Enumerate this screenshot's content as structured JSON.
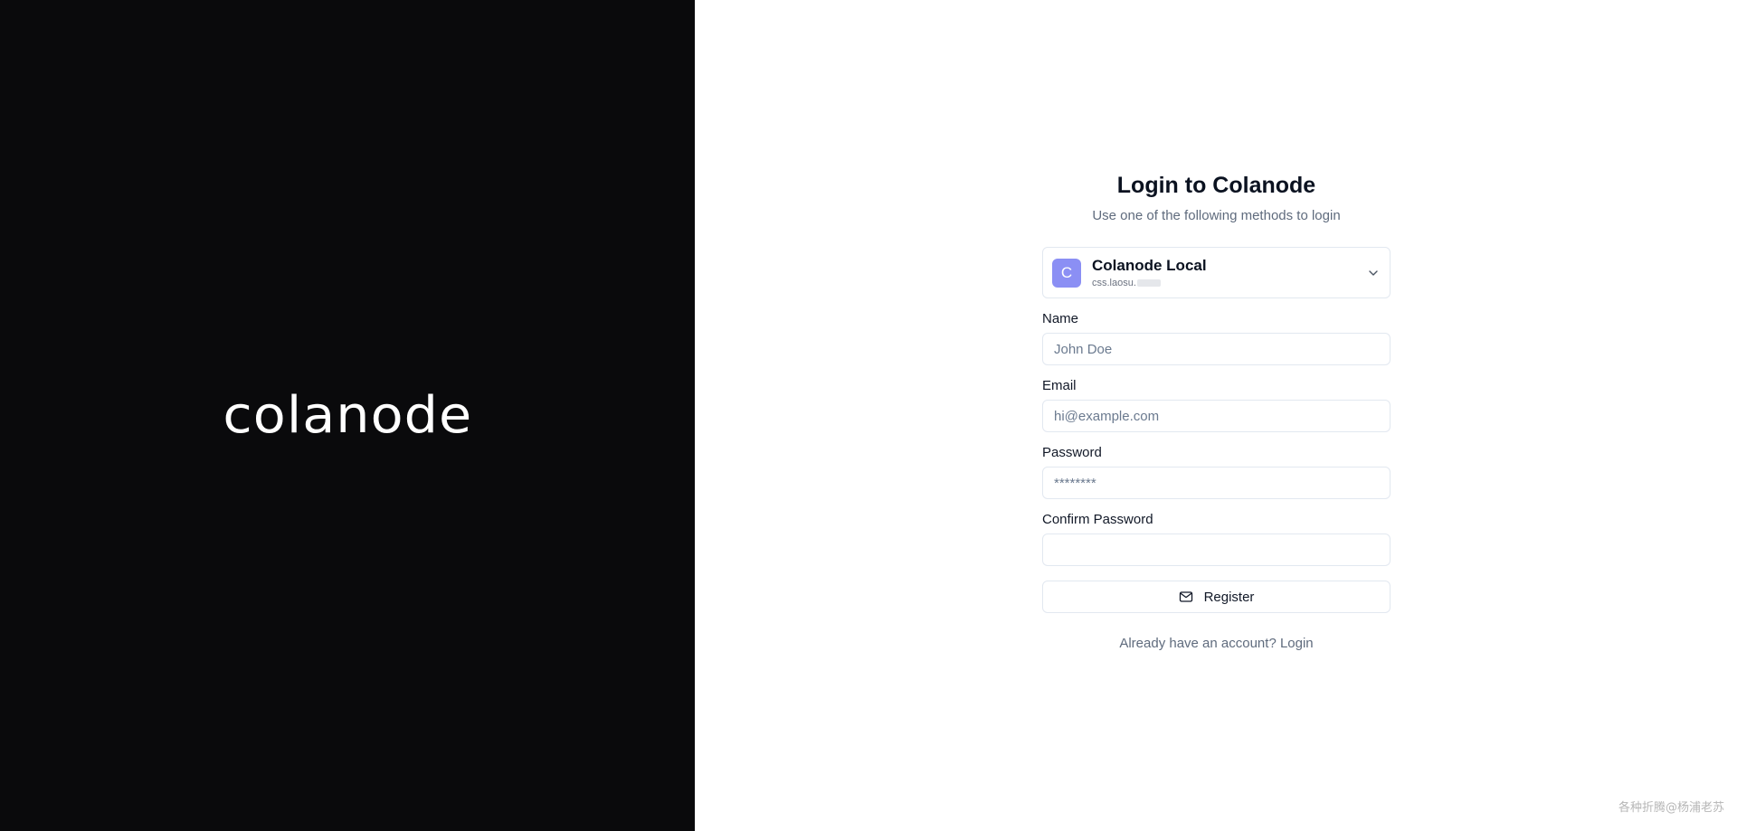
{
  "brand": {
    "wordmark": "colanode"
  },
  "login": {
    "title": "Login to Colanode",
    "subtitle": "Use one of the following methods to login"
  },
  "server": {
    "avatar_letter": "C",
    "name": "Colanode Local",
    "domain": "css.laosu.",
    "avatar_color": "#8b8ff4",
    "icon": "chevron-down-icon"
  },
  "fields": {
    "name": {
      "label": "Name",
      "placeholder": "John Doe"
    },
    "email": {
      "label": "Email",
      "placeholder": "hi@example.com"
    },
    "password": {
      "label": "Password",
      "placeholder": "********"
    },
    "confirm_password": {
      "label": "Confirm Password",
      "placeholder": ""
    }
  },
  "register": {
    "label": "Register",
    "icon": "mail-icon"
  },
  "footer": {
    "login_link": "Already have an account? Login"
  },
  "watermark": "各种折腾@杨浦老苏",
  "colors": {
    "left_panel_bg": "#0a0a0c",
    "text_primary": "#0b1220",
    "muted": "#5f6b7d",
    "border": "#e2e8f0"
  }
}
